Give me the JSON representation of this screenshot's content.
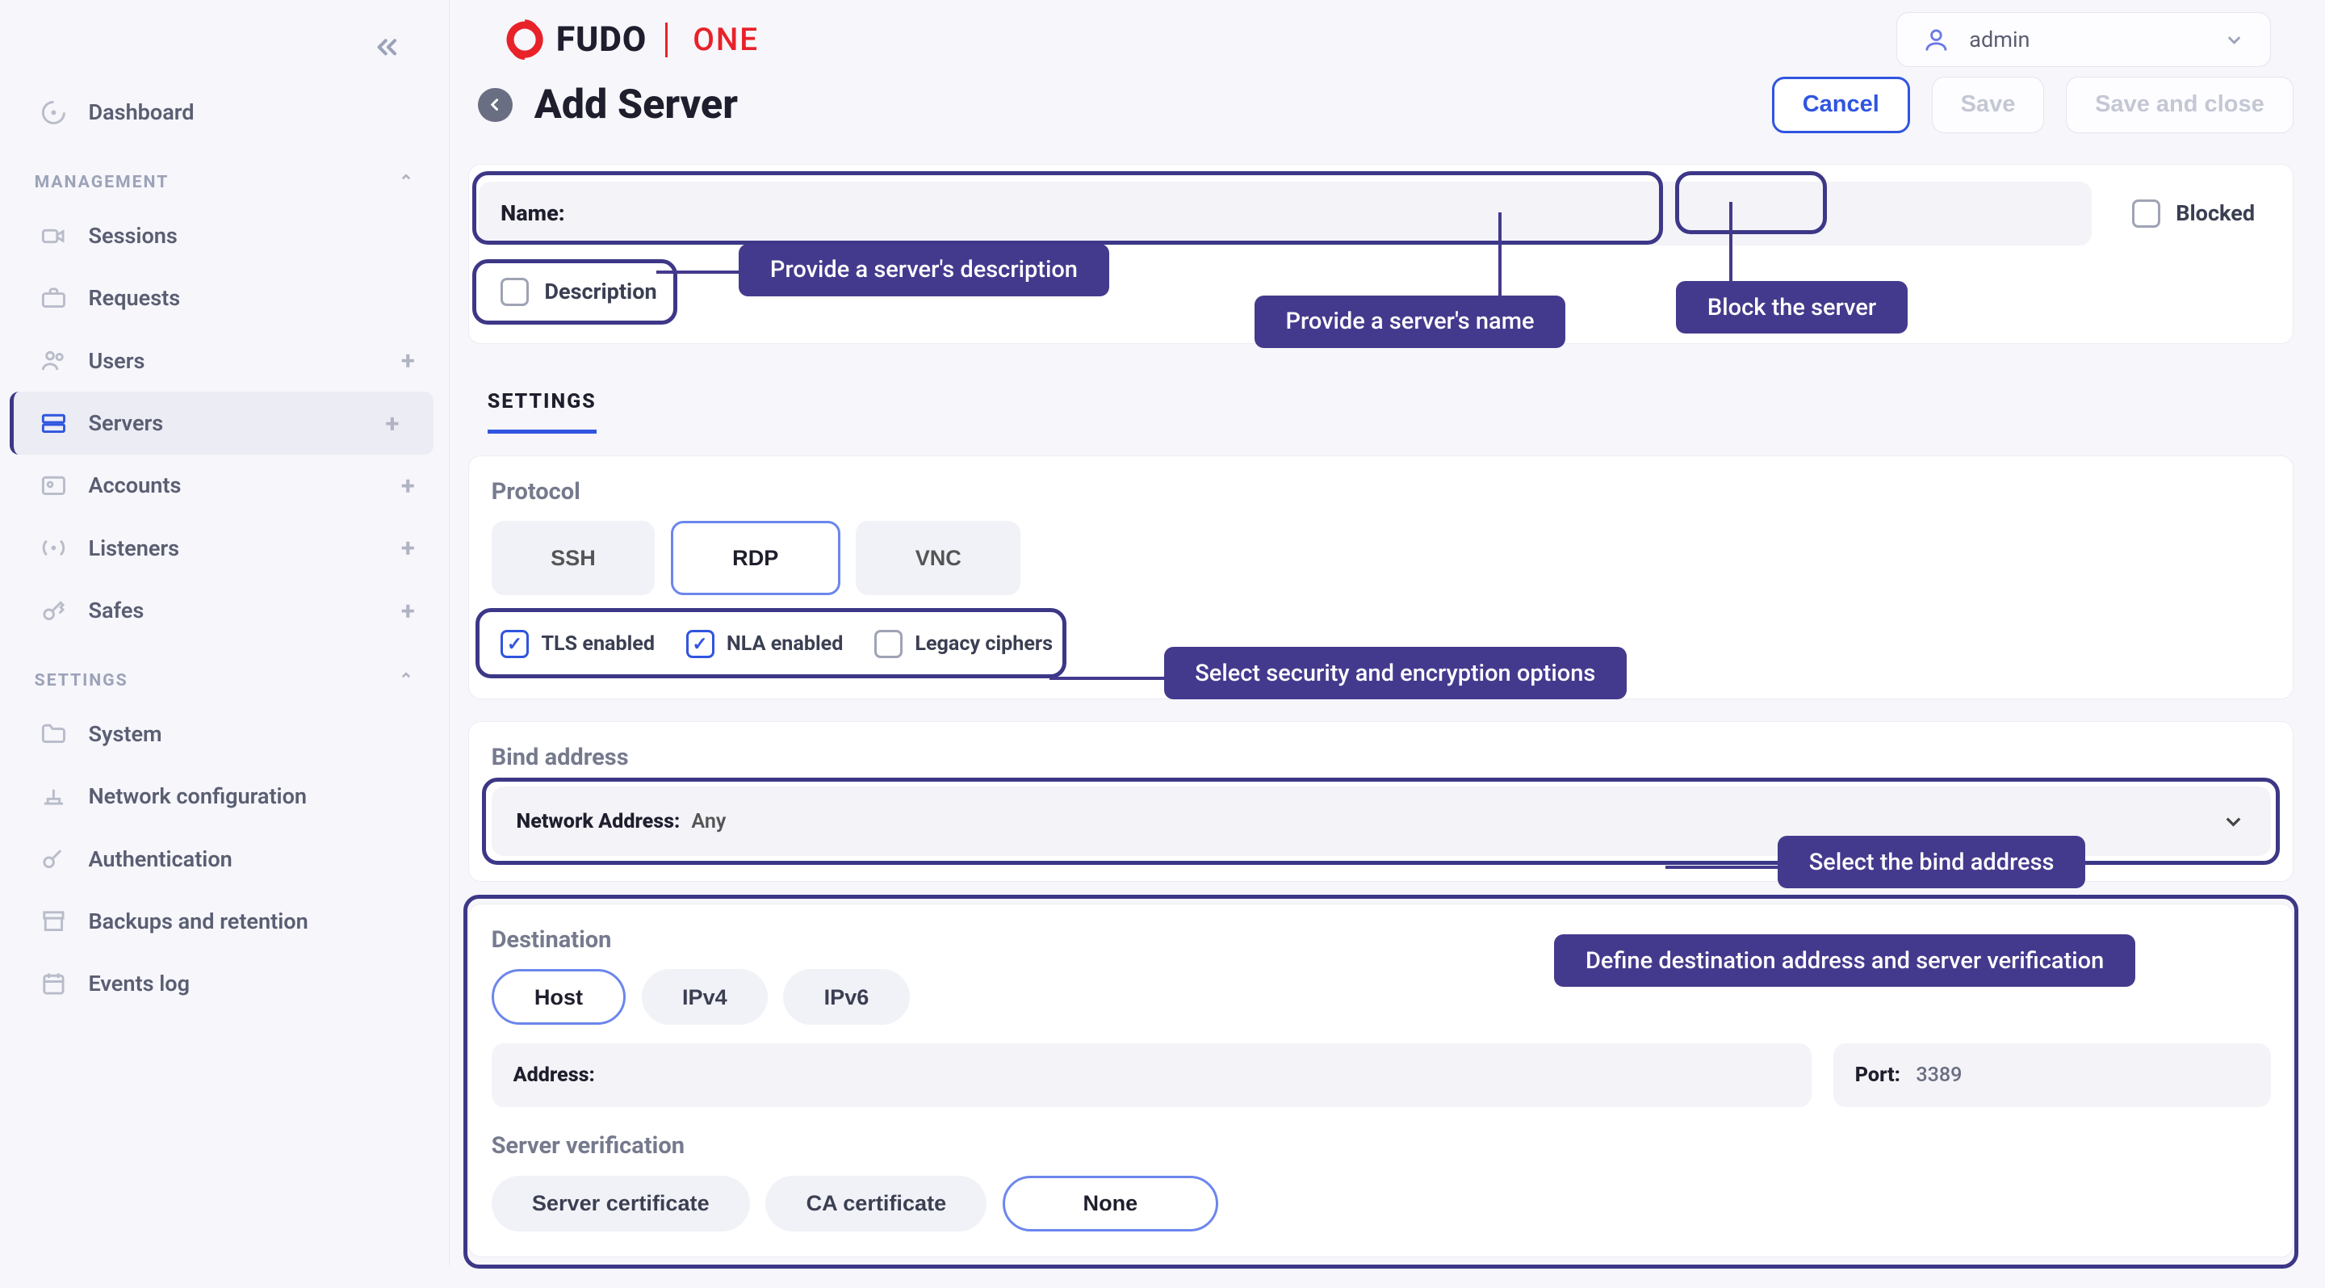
{
  "brand": {
    "name": "FUDO",
    "suffix": "ONE"
  },
  "user": {
    "name": "admin"
  },
  "sidebar": {
    "dashboard": "Dashboard",
    "management_label": "MANAGEMENT",
    "settings_label": "SETTINGS",
    "items": [
      {
        "label": "Sessions"
      },
      {
        "label": "Requests"
      },
      {
        "label": "Users"
      },
      {
        "label": "Servers"
      },
      {
        "label": "Accounts"
      },
      {
        "label": "Listeners"
      },
      {
        "label": "Safes"
      }
    ],
    "settings_items": [
      {
        "label": "System"
      },
      {
        "label": "Network configuration"
      },
      {
        "label": "Authentication"
      },
      {
        "label": "Backups and retention"
      },
      {
        "label": "Events log"
      }
    ]
  },
  "page": {
    "title": "Add Server",
    "cancel": "Cancel",
    "save": "Save",
    "save_close": "Save and close"
  },
  "form": {
    "name_label": "Name:",
    "blocked_label": "Blocked",
    "description_label": "Description",
    "settings_tab": "SETTINGS",
    "protocol_label": "Protocol",
    "protocols": {
      "ssh": "SSH",
      "rdp": "RDP",
      "vnc": "VNC"
    },
    "opts": {
      "tls": "TLS enabled",
      "nla": "NLA enabled",
      "legacy": "Legacy ciphers"
    },
    "bind_label": "Bind address",
    "bind_field_label": "Network Address:",
    "bind_value": "Any",
    "dest_label": "Destination",
    "dest_tabs": {
      "host": "Host",
      "ipv4": "IPv4",
      "ipv6": "IPv6"
    },
    "address_label": "Address:",
    "port_label": "Port:",
    "port_value": "3389",
    "verif_label": "Server verification",
    "verif_opts": {
      "server": "Server certificate",
      "ca": "CA certificate",
      "none": "None"
    }
  },
  "callouts": {
    "desc": "Provide a server's description",
    "name": "Provide a server's name",
    "block": "Block the server",
    "security": "Select security and encryption options",
    "bind": "Select the bind address",
    "dest": "Define destination address and server verification"
  }
}
